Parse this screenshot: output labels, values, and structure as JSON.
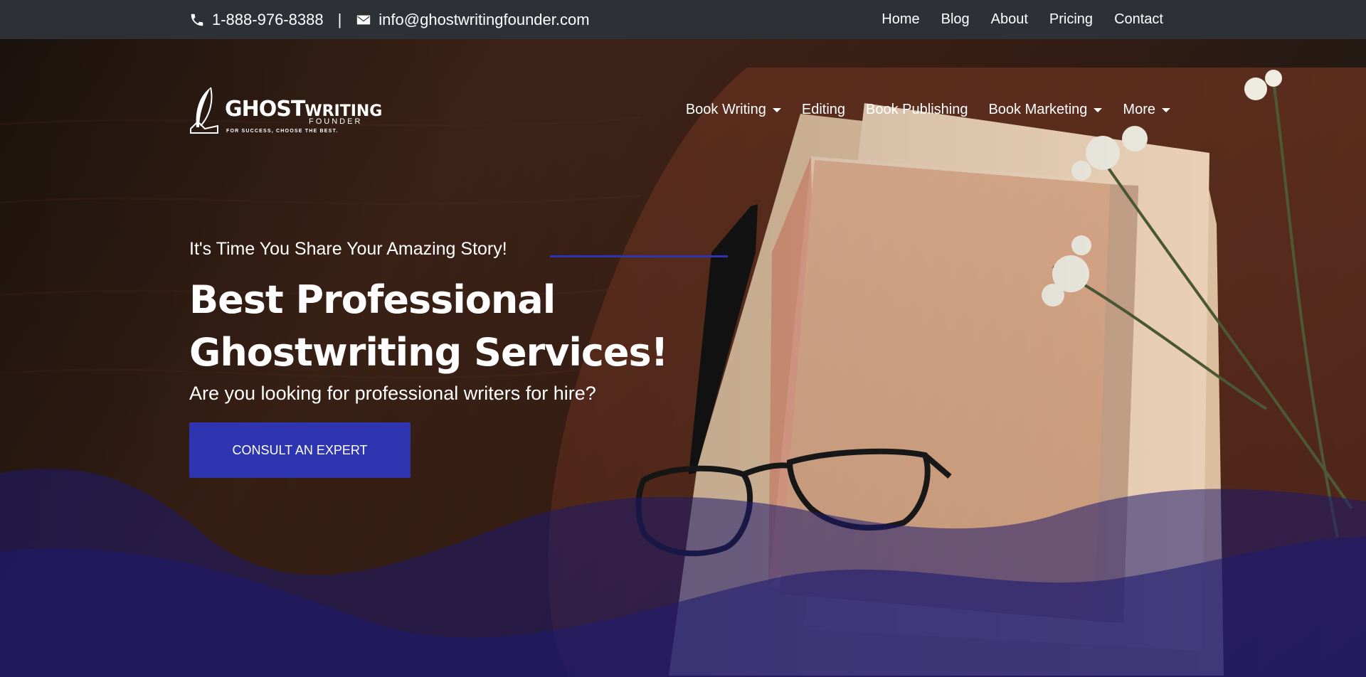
{
  "topbar": {
    "phone": "1-888-976-8388",
    "separator": "|",
    "email": "info@ghostwritingfounder.com",
    "links": [
      "Home",
      "Blog",
      "About",
      "Pricing",
      "Contact"
    ]
  },
  "logo": {
    "brand_ghost": "GHOST",
    "brand_writing": "WRITING",
    "brand_founder": "FOUNDER",
    "tagline": "FOR SUCCESS, CHOOSE THE BEST."
  },
  "nav": {
    "items": [
      {
        "label": "Book Writing",
        "dropdown": true
      },
      {
        "label": "Editing",
        "dropdown": false
      },
      {
        "label": "Book Publishing",
        "dropdown": false
      },
      {
        "label": "Book Marketing",
        "dropdown": true
      },
      {
        "label": "More",
        "dropdown": true
      }
    ]
  },
  "hero": {
    "subtitle": "It's Time You Share Your Amazing Story!",
    "headline_line1": "Best Professional",
    "headline_line2": "Ghostwriting Services!",
    "lead": "Are you looking for professional writers for hire?",
    "cta": "CONSULT AN EXPERT"
  },
  "colors": {
    "topbar_bg": "#2d3136",
    "accent": "#2f35b0",
    "wave": "#1e1a6e"
  }
}
